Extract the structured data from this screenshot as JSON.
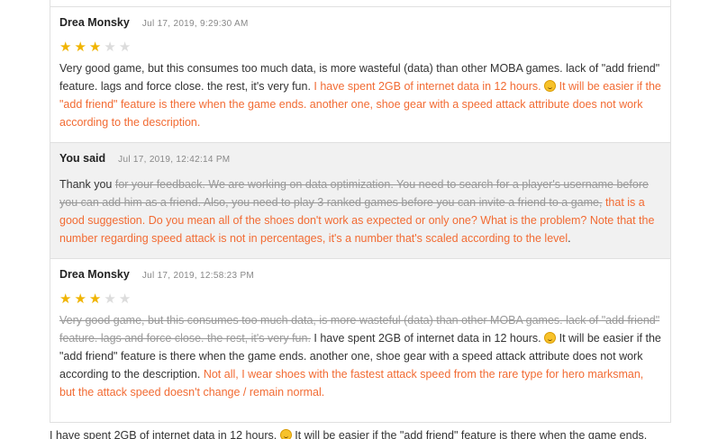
{
  "messages": [
    {
      "author": "Drea Monsky",
      "date": "Jul 17, 2019, 9:29:30 AM",
      "rating": 3,
      "parts": [
        {
          "t": "n",
          "text": "Very good game, but this consumes too much data, is more wasteful (data) than other MOBA games. lack of \"add friend\" feature. lags and force close. the rest, it's very fun. "
        },
        {
          "t": "i",
          "text": "I have spent 2GB of internet data in 12 hours. "
        },
        {
          "t": "e",
          "text": "grinning-face"
        },
        {
          "t": "i",
          "text": " It will be easier if the \"add friend\" feature is there when the game ends. another one, shoe gear with a speed attack attribute does not work according to the description."
        }
      ]
    },
    {
      "author": "You said",
      "date": "Jul 17, 2019, 12:42:14 PM",
      "reply": true,
      "parts": [
        {
          "t": "n",
          "text": "Thank you "
        },
        {
          "t": "d",
          "text": "for your feedback. We are working on data optimization. You need to search for a player's username before you can add him as a friend. Also, you need to play 3 ranked games before you can invite a friend to a game,"
        },
        {
          "t": "i",
          "text": " that is a good suggestion. Do you mean all of the shoes don't work as expected or only one? What is the problem? Note that the number regarding speed attack is not in percentages, it's a number that's scaled according to the level"
        },
        {
          "t": "n",
          "text": "."
        }
      ]
    },
    {
      "author": "Drea Monsky",
      "date": "Jul 17, 2019, 12:58:23 PM",
      "rating": 3,
      "parts": [
        {
          "t": "d",
          "text": "Very good game, but this consumes too much data, is more wasteful (data) than other MOBA games. lack of \"add friend\" feature. lags and force close. the rest, it's very fun."
        },
        {
          "t": "n",
          "text": " I have spent 2GB of internet data in 12 hours. "
        },
        {
          "t": "e",
          "text": "grinning-face"
        },
        {
          "t": "n",
          "text": " It will be easier if the \"add friend\" feature is there when the game ends. another one, shoe gear with a speed attack attribute does not work according to the description. "
        },
        {
          "t": "i",
          "text": "Not all, I wear shoes with the fastest attack speed from the rare type for hero marksman, but the attack speed doesn't change / remain normal."
        }
      ]
    }
  ],
  "cutoff_text": "I have spent 2GB of internet data in 12 hours. ",
  "cutoff_text2": " It will be easier if the \"add friend\" feature is there when the game ends.",
  "colors": {
    "inserted": "#f26b33",
    "deleted": "#999999",
    "star": "#f0b400",
    "reply_bg": "#f1f1f1"
  }
}
